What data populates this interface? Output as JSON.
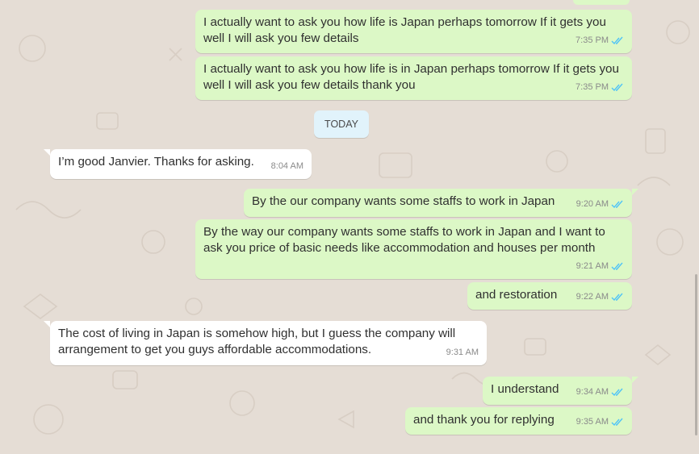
{
  "chat": {
    "date_separator": "TODAY",
    "messages": [
      {
        "direction": "out",
        "text": "I actually want to ask you how life is Japan perhaps tomorrow If it gets you well I will ask you few details",
        "time": "7:35 PM",
        "status": "read"
      },
      {
        "direction": "out",
        "text": "I actually want to ask you how life is in Japan perhaps tomorrow If it gets you well I will ask you few details thank you",
        "time": "7:35 PM",
        "status": "read"
      },
      {
        "direction": "in",
        "text": "I’m good Janvier. Thanks for asking.",
        "time": "8:04 AM"
      },
      {
        "direction": "out",
        "text": "By the our company wants some staffs to work in Japan",
        "time": "9:20 AM",
        "status": "read"
      },
      {
        "direction": "out",
        "text": "By the way our company wants some staffs to work in Japan and I want to ask you price of basic needs like accommodation and houses per month",
        "time": "9:21 AM",
        "status": "read"
      },
      {
        "direction": "out",
        "text": "and restoration",
        "time": "9:22 AM",
        "status": "read"
      },
      {
        "direction": "in",
        "text": "The cost of living in Japan is somehow high, but I guess the company will arrangement to get you guys affordable accommodations.",
        "time": "9:31 AM"
      },
      {
        "direction": "out",
        "text": "I understand",
        "time": "9:34 AM",
        "status": "read"
      },
      {
        "direction": "out",
        "text": "and thank you for replying",
        "time": "9:35 AM",
        "status": "read"
      }
    ]
  },
  "colors": {
    "background": "#e5ddd5",
    "outgoing_bubble": "#dcf8c6",
    "incoming_bubble": "#ffffff",
    "date_pill": "#e1f3fb",
    "read_tick": "#4fc3f7"
  },
  "icons": {
    "read_receipt": "double-check-icon"
  }
}
